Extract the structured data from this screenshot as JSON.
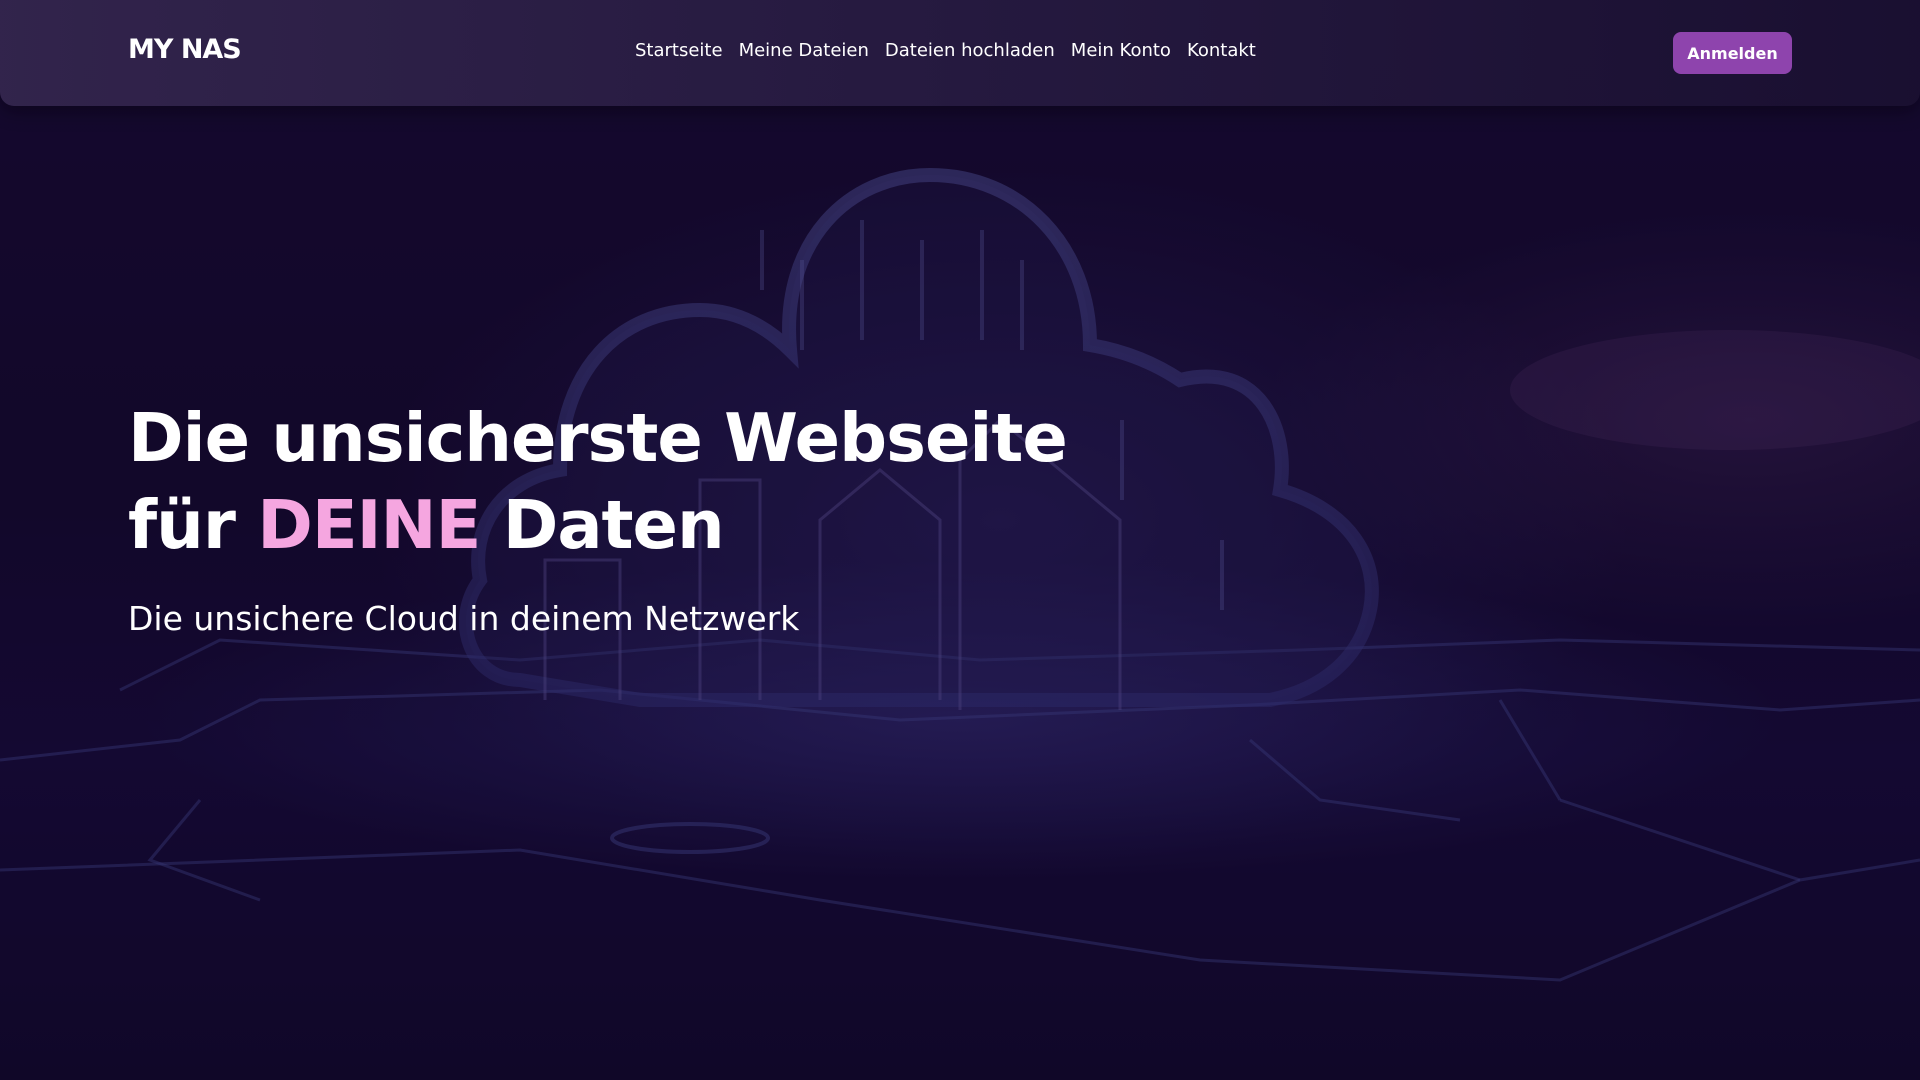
{
  "navbar": {
    "brand": "MY NAS",
    "links": [
      {
        "label": "Startseite"
      },
      {
        "label": "Meine Dateien"
      },
      {
        "label": "Dateien hochladen"
      },
      {
        "label": "Mein Konto"
      },
      {
        "label": "Kontakt"
      }
    ],
    "login_label": "Anmelden"
  },
  "hero": {
    "title_line1": "Die unsicherste Webseite",
    "title_line2_prefix": "für",
    "title_line2_accent": "DEINE",
    "title_line2_suffix": "Daten",
    "subtitle": "Die unsichere Cloud in deinem Netzwerk"
  },
  "colors": {
    "accent": "#f5a6e0",
    "button": "#8e44ad",
    "background": "#12072a"
  }
}
